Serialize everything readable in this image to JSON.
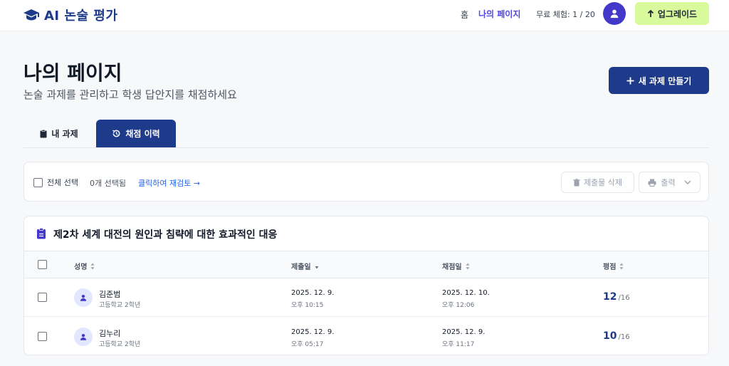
{
  "nav": {
    "brand": "AI 논술 평가",
    "home": "홈",
    "mypage": "나의 페이지",
    "trial": "무료 체험: 1 / 20",
    "upgrade": "업그레이드"
  },
  "page": {
    "title": "나의 페이지",
    "subtitle": "논술 과제를 관리하고 학생 답안지를 채점하세요",
    "new_task": "새 과제 만들기"
  },
  "tabs": [
    {
      "label": "내 과제",
      "active": false
    },
    {
      "label": "채점 이력",
      "active": true
    }
  ],
  "toolbar": {
    "select_all": "전체 선택",
    "selected_count": "0개 선택됨",
    "regrade": "클릭하여 재검토 →",
    "delete": "제출물 삭제",
    "print": "출력"
  },
  "assignment": {
    "title": "제2차 세계 대전의 원인과 침략에 대한 효과적인 대응",
    "columns": [
      "성명",
      "제출일",
      "채점일",
      "평점"
    ],
    "rows": [
      {
        "name": "김준범",
        "school": "고등학교 2학년",
        "submitted_date": "2025. 12. 9.",
        "submitted_time": "오후 10:15",
        "graded_date": "2025. 12. 10.",
        "graded_time": "오후 12:06",
        "score": "12",
        "max": "/16"
      },
      {
        "name": "김누리",
        "school": "고등학교 2학년",
        "submitted_date": "2025. 12. 9.",
        "submitted_time": "오후 05:17",
        "graded_date": "2025. 12. 9.",
        "graded_time": "오후 11:17",
        "score": "10",
        "max": "/16"
      }
    ]
  },
  "colors": {
    "primary": "#1e3a8a",
    "accent": "#4f46e5",
    "upgrade_bg": "#d9f99d",
    "link": "#2563eb"
  }
}
